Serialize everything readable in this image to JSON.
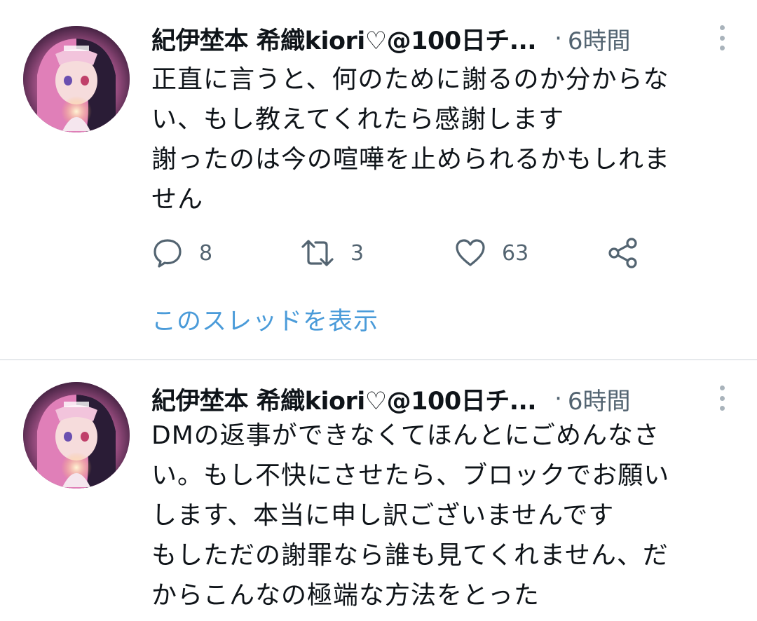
{
  "tweets": [
    {
      "display_name": "紀伊埜本 希織kiori♡@100日チ...",
      "separator": "·",
      "timestamp": "6時間",
      "body_lines": [
        "正直に言うと、何のために謝るのか分からな",
        "い、もし教えてくれたら感謝します",
        "謝ったのは今の喧嘩を止められるかもしれま",
        "せん"
      ],
      "actions": {
        "reply_count": "8",
        "retweet_count": "3",
        "like_count": "63"
      },
      "show_thread_label": "このスレッドを表示"
    },
    {
      "display_name": "紀伊埜本 希織kiori♡@100日チ...",
      "separator": "·",
      "timestamp": "6時間",
      "body_lines": [
        "DMの返事ができなくてほんとにごめんなさ",
        "い。もし不快にさせたら、ブロックでお願い",
        "します、本当に申し訳ございませんです",
        "もしただの謝罪なら誰も見てくれません、だ",
        "からこんなの極端な方法をとった"
      ]
    }
  ],
  "icons": {
    "reply": "comment-bubble-icon",
    "retweet": "retweet-arrows-icon",
    "like": "heart-icon",
    "share": "share-nodes-icon",
    "more": "vertical-ellipsis-icon"
  },
  "colors": {
    "text": "#0f1419",
    "secondary": "#536471",
    "link": "#4a9bd9",
    "divider": "#e6e9ec"
  }
}
